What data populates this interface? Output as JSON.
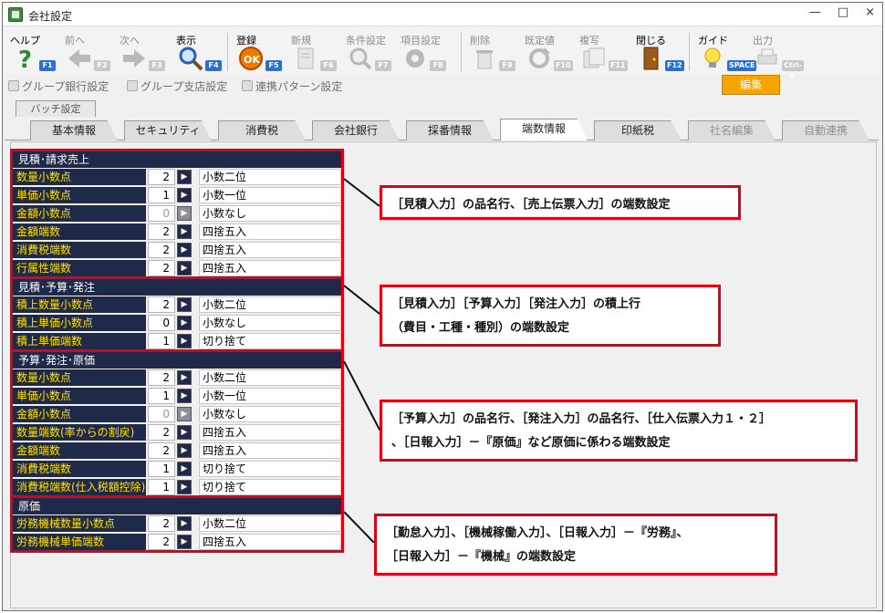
{
  "window": {
    "title": "会社設定",
    "controls": [
      "—",
      "□",
      "×"
    ]
  },
  "toolbar": {
    "buttons": [
      {
        "id": "help",
        "label": "ヘルプ",
        "key": "F1",
        "icon": "help-icon",
        "enabled": true
      },
      {
        "id": "prev",
        "label": "前へ",
        "key": "F2",
        "icon": "arrow-left-icon",
        "enabled": false
      },
      {
        "id": "next",
        "label": "次へ",
        "key": "F3",
        "icon": "arrow-right-icon",
        "enabled": false
      },
      {
        "id": "display",
        "label": "表示",
        "key": "F4",
        "icon": "magnifier-icon",
        "enabled": true
      },
      {
        "id": "register",
        "label": "登録",
        "key": "F5",
        "icon": "ok-icon",
        "enabled": true
      },
      {
        "id": "new",
        "label": "新規",
        "key": "F6",
        "icon": "new-doc-icon",
        "enabled": false
      },
      {
        "id": "cond",
        "label": "条件設定",
        "key": "F7",
        "icon": "search-gear-icon",
        "enabled": false
      },
      {
        "id": "item",
        "label": "項目設定",
        "key": "F8",
        "icon": "gear-icon",
        "enabled": false
      },
      {
        "id": "delete",
        "label": "削除",
        "key": "F9",
        "icon": "trash-icon",
        "enabled": false
      },
      {
        "id": "default",
        "label": "既定値",
        "key": "F10",
        "icon": "refresh-icon",
        "enabled": false
      },
      {
        "id": "copy",
        "label": "複写",
        "key": "F11",
        "icon": "copy-icon",
        "enabled": false
      },
      {
        "id": "close",
        "label": "閉じる",
        "key": "F12",
        "icon": "door-icon",
        "enabled": true
      },
      {
        "id": "guide",
        "label": "ガイド",
        "key": "SPACE",
        "icon": "lightbulb-icon",
        "enabled": true
      },
      {
        "id": "output",
        "label": "出力",
        "key": "Ctrl-P",
        "icon": "printer-icon",
        "enabled": false
      }
    ]
  },
  "actionbar": {
    "items": [
      "グループ銀行設定",
      "グループ支店設定",
      "連携パターン設定"
    ],
    "edit_label": "編集"
  },
  "tabs": {
    "batch": "バッチ設定",
    "items": [
      {
        "label": "基本情報",
        "state": "normal"
      },
      {
        "label": "セキュリティ",
        "state": "normal"
      },
      {
        "label": "消費税",
        "state": "normal"
      },
      {
        "label": "会社銀行",
        "state": "normal"
      },
      {
        "label": "採番情報",
        "state": "normal"
      },
      {
        "label": "端数情報",
        "state": "active"
      },
      {
        "label": "印紙税",
        "state": "normal"
      },
      {
        "label": "社名編集",
        "state": "disabled"
      },
      {
        "label": "自動連携",
        "state": "disabled"
      }
    ]
  },
  "sections": [
    {
      "title": "見積･請求売上",
      "rows": [
        {
          "name": "数量小数点",
          "value": "2",
          "desc": "小数二位",
          "dim": false
        },
        {
          "name": "単価小数点",
          "value": "1",
          "desc": "小数一位",
          "dim": false
        },
        {
          "name": "金額小数点",
          "value": "0",
          "desc": "小数なし",
          "dim": true
        },
        {
          "name": "金額端数",
          "value": "2",
          "desc": "四捨五入",
          "dim": false
        },
        {
          "name": "消費税端数",
          "value": "2",
          "desc": "四捨五入",
          "dim": false
        },
        {
          "name": "行属性端数",
          "value": "2",
          "desc": "四捨五入",
          "dim": false
        }
      ]
    },
    {
      "title": "見積･予算･発注",
      "rows": [
        {
          "name": "積上数量小数点",
          "value": "2",
          "desc": "小数二位",
          "dim": false
        },
        {
          "name": "積上単価小数点",
          "value": "0",
          "desc": "小数なし",
          "dim": false
        },
        {
          "name": "積上単価端数",
          "value": "1",
          "desc": "切り捨て",
          "dim": false
        }
      ]
    },
    {
      "title": "予算･発注･原価",
      "rows": [
        {
          "name": "数量小数点",
          "value": "2",
          "desc": "小数二位",
          "dim": false
        },
        {
          "name": "単価小数点",
          "value": "1",
          "desc": "小数一位",
          "dim": false
        },
        {
          "name": "金額小数点",
          "value": "0",
          "desc": "小数なし",
          "dim": true
        },
        {
          "name": "数量端数(率からの割戻)",
          "value": "2",
          "desc": "四捨五入",
          "dim": false
        },
        {
          "name": "金額端数",
          "value": "2",
          "desc": "四捨五入",
          "dim": false
        },
        {
          "name": "消費税端数",
          "value": "1",
          "desc": "切り捨て",
          "dim": false
        },
        {
          "name": "消費税端数(仕入税額控除)",
          "value": "1",
          "desc": "切り捨て",
          "dim": false
        }
      ]
    },
    {
      "title": "原価",
      "rows": [
        {
          "name": "労務機械数量小数点",
          "value": "2",
          "desc": "小数二位",
          "dim": false
        },
        {
          "name": "労務機械単価端数",
          "value": "2",
          "desc": "四捨五入",
          "dim": false
        }
      ]
    }
  ],
  "callouts": [
    {
      "lines": [
        "［見積入力］の品名行、［売上伝票入力］の端数設定"
      ]
    },
    {
      "lines": [
        "［見積入力］［予算入力］［発注入力］の積上行",
        "（費目・工種・種別）の端数設定"
      ]
    },
    {
      "lines": [
        "［予算入力］の品名行、［発注入力］の品名行、［仕入伝票入力１・２］",
        "、［日報入力］－『原価』など原価に係わる端数設定"
      ]
    },
    {
      "lines": [
        "［勤怠入力］、［機械稼働入力］、［日報入力］－『労務』、",
        "［日報入力］－『機械』の端数設定"
      ]
    }
  ],
  "colors": {
    "accent_red": "#e00016",
    "header_navy": "#1f2a4a",
    "label_yellow": "#ffe100",
    "edit_orange": "#f5a400"
  }
}
